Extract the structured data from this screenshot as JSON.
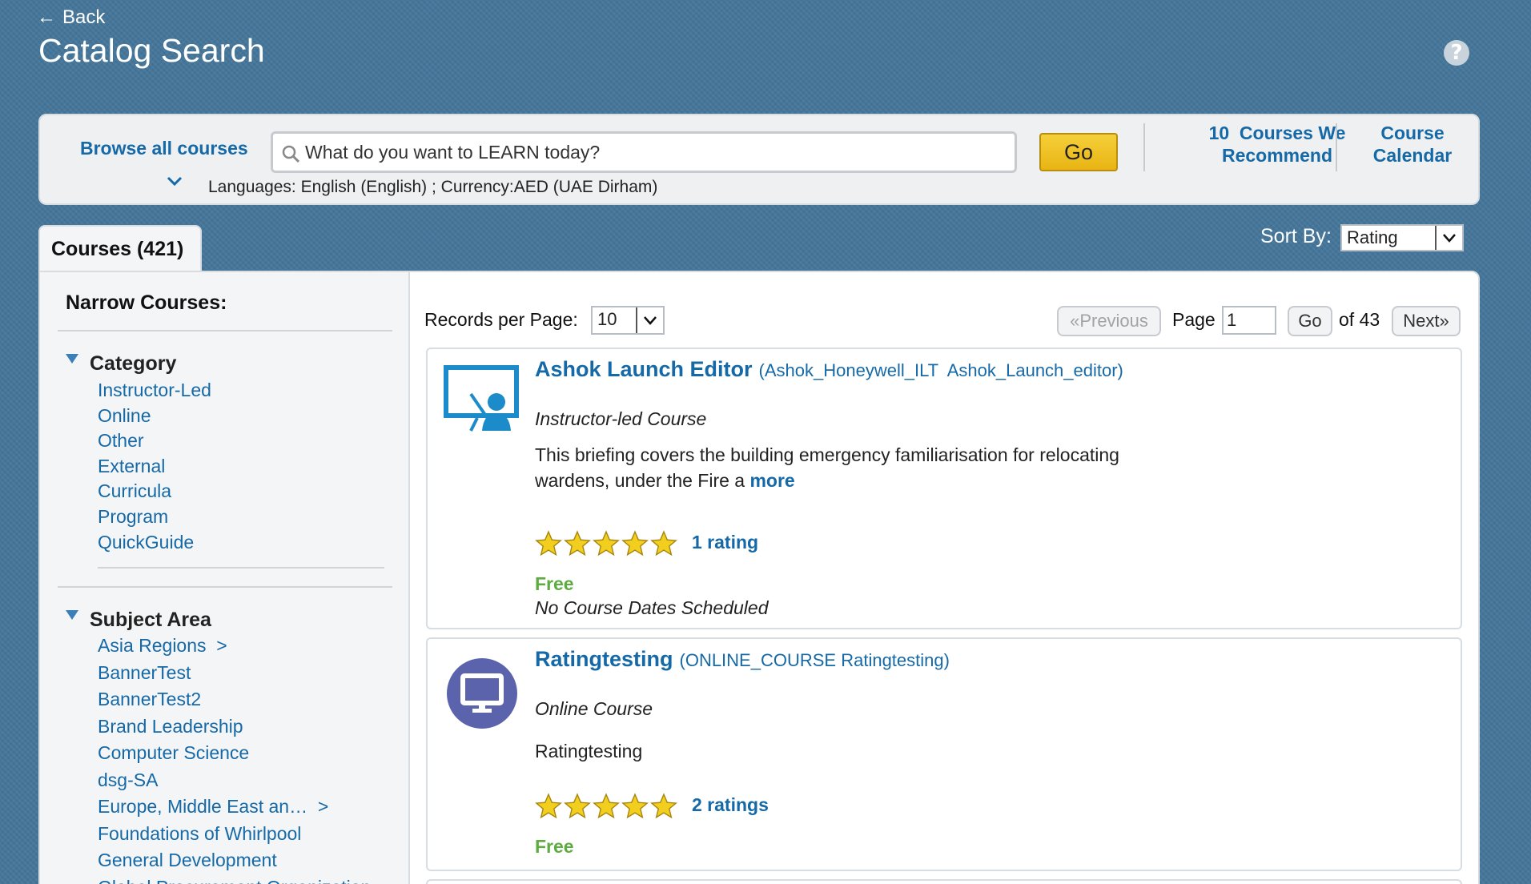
{
  "header": {
    "back_label": "Back",
    "back_arrow": "←",
    "title": "Catalog Search",
    "help_icon": "?"
  },
  "search": {
    "browse_label": "Browse all courses",
    "placeholder": "What do you want to LEARN today?",
    "go_label": "Go",
    "language_info": "Languages: English (English) ; Currency:AED (UAE Dirham)",
    "recommend_line1": "10  Courses We",
    "recommend_line2": "Recommend",
    "calendar_line1": "Course",
    "calendar_line2": "Calendar"
  },
  "tabs": {
    "courses_label": "Courses (421)"
  },
  "sort": {
    "label": "Sort By:",
    "value": "Rating"
  },
  "sidebar": {
    "title": "Narrow Courses:",
    "category": {
      "title": "Category",
      "items": [
        "Instructor-Led",
        "Online",
        "Other",
        "External",
        "Curricula",
        "Program",
        "QuickGuide"
      ]
    },
    "subject": {
      "title": "Subject Area",
      "items": [
        "Asia Regions  >",
        "BannerTest",
        "BannerTest2",
        "Brand Leadership",
        "Computer Science",
        "dsg-SA",
        "Europe, Middle East an…  >",
        "Foundations of Whirlpool",
        "General Development",
        "Global Procurement Organization"
      ]
    }
  },
  "pagination": {
    "records_label": "Records per Page:",
    "records_value": "10",
    "previous_label": "«Previous",
    "page_label": "Page",
    "page_value": "1",
    "go_label": "Go",
    "of_label": "of 43",
    "next_label": "Next»"
  },
  "courses": [
    {
      "title": "Ashok Launch Editor",
      "code": "(Ashok_Honeywell_ILT  Ashok_Launch_editor)",
      "type": "Instructor-led Course",
      "description_line1": "This briefing covers the building emergency familiarisation for relocating",
      "description_line2": "wardens, under the Fire a",
      "more_label": "more",
      "rating_label": "1 rating",
      "rating": 5,
      "price": "Free",
      "dates": "No Course Dates Scheduled",
      "icon": "instructor-led-icon"
    },
    {
      "title": "Ratingtesting",
      "code": "(ONLINE_COURSE Ratingtesting)",
      "type": "Online Course",
      "description_line1": "Ratingtesting",
      "rating_label": "2 ratings",
      "rating": 5,
      "price": "Free",
      "icon": "online-course-icon"
    }
  ],
  "colors": {
    "link": "#1669a7",
    "background": "#45769a",
    "go_button": "#f0c32a",
    "price": "#5cac3f",
    "star": "#f2cf1f"
  }
}
